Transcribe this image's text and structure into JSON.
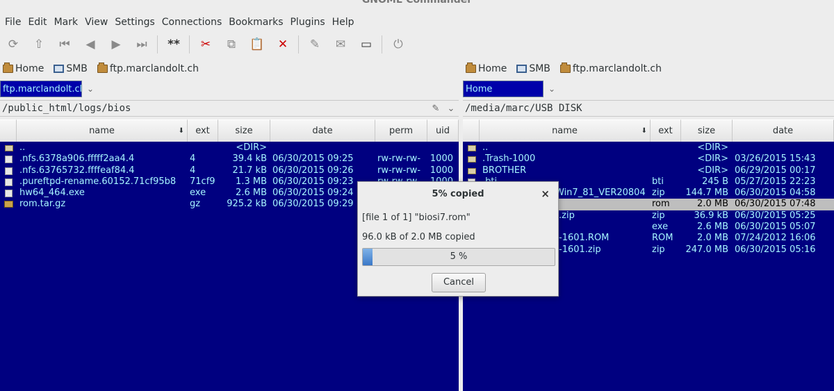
{
  "app": {
    "title": "GNOME Commander"
  },
  "menu": [
    "File",
    "Edit",
    "Mark",
    "View",
    "Settings",
    "Connections",
    "Bookmarks",
    "Plugins",
    "Help"
  ],
  "toolbar": {
    "refresh": "⟳",
    "up": "⇧",
    "first": "⏮",
    "back": "◀",
    "forward": "▶",
    "last": "⏭",
    "mark": "**",
    "cut": "✂",
    "copy": "⧉",
    "paste": "📋",
    "delete": "✕",
    "edit": "✎",
    "mail": "✉",
    "terminal": "▭",
    "remote": "⏻"
  },
  "left": {
    "bookmarks": [
      {
        "label": "Home"
      },
      {
        "label": "SMB"
      },
      {
        "label": "ftp.marclandolt.ch"
      }
    ],
    "connection": "ftp.marclandolt.ch",
    "path": "/public_html/logs/bios",
    "columns": [
      "name",
      "ext",
      "size",
      "date",
      "perm",
      "uid"
    ],
    "rows": [
      {
        "name": "..",
        "ext": "",
        "size": "<DIR>",
        "date": "",
        "perm": "",
        "uid": "",
        "icon": "dir"
      },
      {
        "name": ".nfs.6378a906.fffff2aa4.4",
        "ext": "4",
        "size": "39.4 kB",
        "date": "06/30/2015 09:25",
        "perm": "rw-rw-rw-",
        "uid": "1000",
        "icon": "file"
      },
      {
        "name": ".nfs.63765732.ffffeaf84.4",
        "ext": "4",
        "size": "21.7 kB",
        "date": "06/30/2015 09:26",
        "perm": "rw-rw-rw-",
        "uid": "1000",
        "icon": "file"
      },
      {
        "name": ".pureftpd-rename.60152.71cf95b8",
        "ext": "71cf9",
        "size": "1.3 MB",
        "date": "06/30/2015 09:23",
        "perm": "rw-rw-rw-",
        "uid": "1000",
        "icon": "file"
      },
      {
        "name": "hw64_464.exe",
        "ext": "exe",
        "size": "2.6 MB",
        "date": "06/30/2015 09:24",
        "perm": "",
        "uid": "",
        "icon": "file"
      },
      {
        "name": "rom.tar.gz",
        "ext": "gz",
        "size": "925.2 kB",
        "date": "06/30/2015 09:29",
        "perm": "",
        "uid": "",
        "icon": "archive"
      }
    ]
  },
  "right": {
    "bookmarks": [
      {
        "label": "Home"
      },
      {
        "label": "SMB"
      },
      {
        "label": "ftp.marclandolt.ch"
      }
    ],
    "connection": "Home",
    "path": "/media/marc/USB DISK",
    "columns": [
      "name",
      "ext",
      "size",
      "date"
    ],
    "rows": [
      {
        "name": "..",
        "ext": "",
        "size": "<DIR>",
        "date": "",
        "icon": "dir"
      },
      {
        "name": ".Trash-1000",
        "ext": "",
        "size": "<DIR>",
        "date": "03/26/2015 15:43",
        "icon": "dir"
      },
      {
        "name": "BROTHER",
        "ext": "",
        "size": "<DIR>",
        "date": "06/29/2015 00:17",
        "icon": "dir"
      },
      {
        "name": ".bti",
        "ext": "bti",
        "size": "245 B",
        "date": "05/27/2015 22:23",
        "icon": "file"
      },
      {
        "name": "Win7_81_VER20804",
        "ext": "zip",
        "size": "144.7 MB",
        "date": "06/30/2015 04:58",
        "icon": "file"
      },
      {
        "name": "",
        "ext": "rom",
        "size": "2.0 MB",
        "date": "06/30/2015 07:48",
        "icon": "file",
        "highlight": true
      },
      {
        "name": ".zip",
        "ext": "zip",
        "size": "36.9 kB",
        "date": "06/30/2015 05:25",
        "icon": "file"
      },
      {
        "name": "",
        "ext": "exe",
        "size": "2.6 MB",
        "date": "06/30/2015 05:07",
        "icon": "file"
      },
      {
        "name": "-1601.ROM",
        "ext": "ROM",
        "size": "2.0 MB",
        "date": "07/24/2012 16:06",
        "icon": "file"
      },
      {
        "name": "-1601.zip",
        "ext": "zip",
        "size": "247.0 MB",
        "date": "06/30/2015 05:16",
        "icon": "file"
      }
    ]
  },
  "dialog": {
    "title": "5% copied",
    "file_line": "[file 1 of 1] \"biosi7.rom\"",
    "bytes_line": "96.0 kB  of 2.0 MB  copied",
    "progress_label": "5 %",
    "progress": 0.05,
    "cancel_label": "Cancel",
    "close_glyph": "×"
  },
  "colors": {
    "panel_bg": "#000080",
    "panel_text": "#a6f5ff",
    "highlight_row": "#bebebe"
  }
}
